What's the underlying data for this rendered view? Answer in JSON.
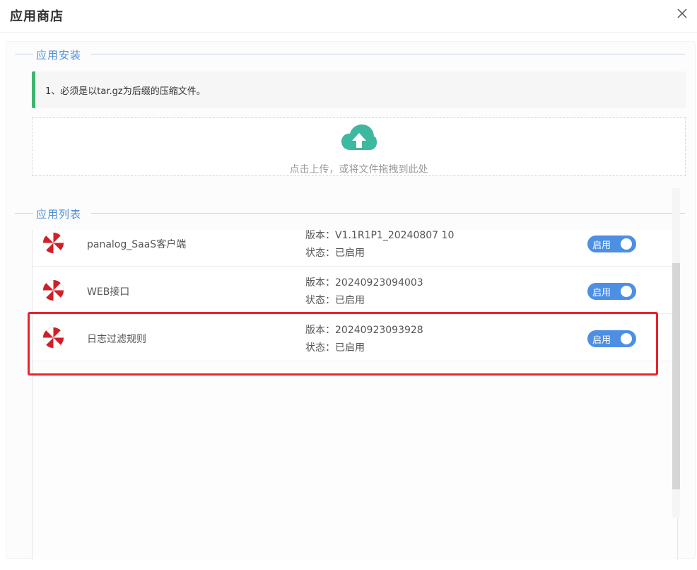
{
  "dialog": {
    "title": "应用商店",
    "close_icon": "close-icon"
  },
  "install_section": {
    "legend": "应用安装",
    "notice": "1、必须是以tar.gz为后缀的压缩文件。",
    "upload": {
      "icon": "cloud-upload-icon",
      "text": "点击上传，或将文件拖拽到此处"
    },
    "colors": {
      "accent": "#4f8fd8",
      "notice_bar": "#3fb56f",
      "cloud": "#3fb8a0"
    }
  },
  "list_section": {
    "legend": "应用列表",
    "apps": [
      {
        "name": "panalog_SaaS客户端",
        "version_label": "版本：",
        "version": "V1.1R1P1_20240807 10",
        "status_label": "状态：",
        "status": "已启用",
        "toggle_label": "启用"
      },
      {
        "name": "WEB接口",
        "version_label": "版本：",
        "version": "20240923094003",
        "status_label": "状态：",
        "status": "已启用",
        "toggle_label": "启用"
      },
      {
        "name": "日志过滤规则",
        "version_label": "版本：",
        "version": "20240923093928",
        "status_label": "状态：",
        "status": "已启用",
        "toggle_label": "启用"
      }
    ],
    "colors": {
      "toggle_on": "#4d8fe3",
      "highlight": "#e8232d"
    }
  }
}
